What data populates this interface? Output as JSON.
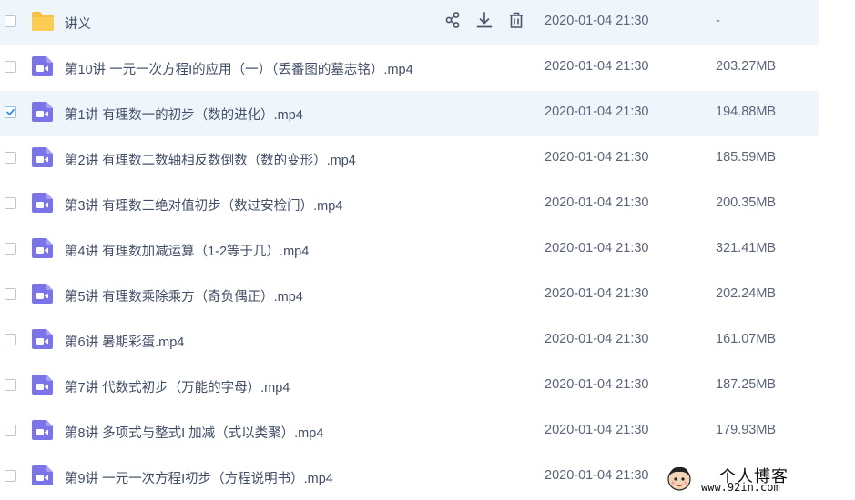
{
  "files": [
    {
      "name": "讲义",
      "time": "2020-01-04 21:30",
      "size": "-",
      "type": "folder",
      "checked": false,
      "highlight": true,
      "show_actions": true
    },
    {
      "name": "第10讲 一元一次方程I的应用（一）（丢番图的墓志铭）.mp4",
      "time": "2020-01-04 21:30",
      "size": "203.27MB",
      "type": "video",
      "checked": false,
      "highlight": false
    },
    {
      "name": "第1讲 有理数一的初步（数的进化）.mp4",
      "time": "2020-01-04 21:30",
      "size": "194.88MB",
      "type": "video",
      "checked": true,
      "highlight": true
    },
    {
      "name": "第2讲 有理数二数轴相反数倒数（数的变形）.mp4",
      "time": "2020-01-04 21:30",
      "size": "185.59MB",
      "type": "video",
      "checked": false,
      "highlight": false
    },
    {
      "name": "第3讲 有理数三绝对值初步（数过安检门）.mp4",
      "time": "2020-01-04 21:30",
      "size": "200.35MB",
      "type": "video",
      "checked": false,
      "highlight": false
    },
    {
      "name": "第4讲 有理数加减运算（1-2等于几）.mp4",
      "time": "2020-01-04 21:30",
      "size": "321.41MB",
      "type": "video",
      "checked": false,
      "highlight": false
    },
    {
      "name": "第5讲 有理数乘除乘方（奇负偶正）.mp4",
      "time": "2020-01-04 21:30",
      "size": "202.24MB",
      "type": "video",
      "checked": false,
      "highlight": false
    },
    {
      "name": "第6讲 暑期彩蛋.mp4",
      "time": "2020-01-04 21:30",
      "size": "161.07MB",
      "type": "video",
      "checked": false,
      "highlight": false
    },
    {
      "name": "第7讲 代数式初步（万能的字母）.mp4",
      "time": "2020-01-04 21:30",
      "size": "187.25MB",
      "type": "video",
      "checked": false,
      "highlight": false
    },
    {
      "name": "第8讲 多项式与整式I 加减（式以类聚）.mp4",
      "time": "2020-01-04 21:30",
      "size": "179.93MB",
      "type": "video",
      "checked": false,
      "highlight": false
    },
    {
      "name": "第9讲 一元一次方程I初步（方程说明书）.mp4",
      "time": "2020-01-04 21:30",
      "size": "",
      "type": "video",
      "checked": false,
      "highlight": false
    }
  ],
  "row_actions": [
    {
      "icon": "share-icon"
    },
    {
      "icon": "download-icon"
    },
    {
      "icon": "delete-icon"
    }
  ],
  "colors": {
    "row_highlight": "#eef6fc",
    "folder": "#f8c03e",
    "video": "#7b73e8",
    "action_icon": "#4b5568",
    "checkbox_tick": "#2d8cf0"
  },
  "watermark": {
    "title": "个人博客",
    "url": "www.92in.com"
  }
}
